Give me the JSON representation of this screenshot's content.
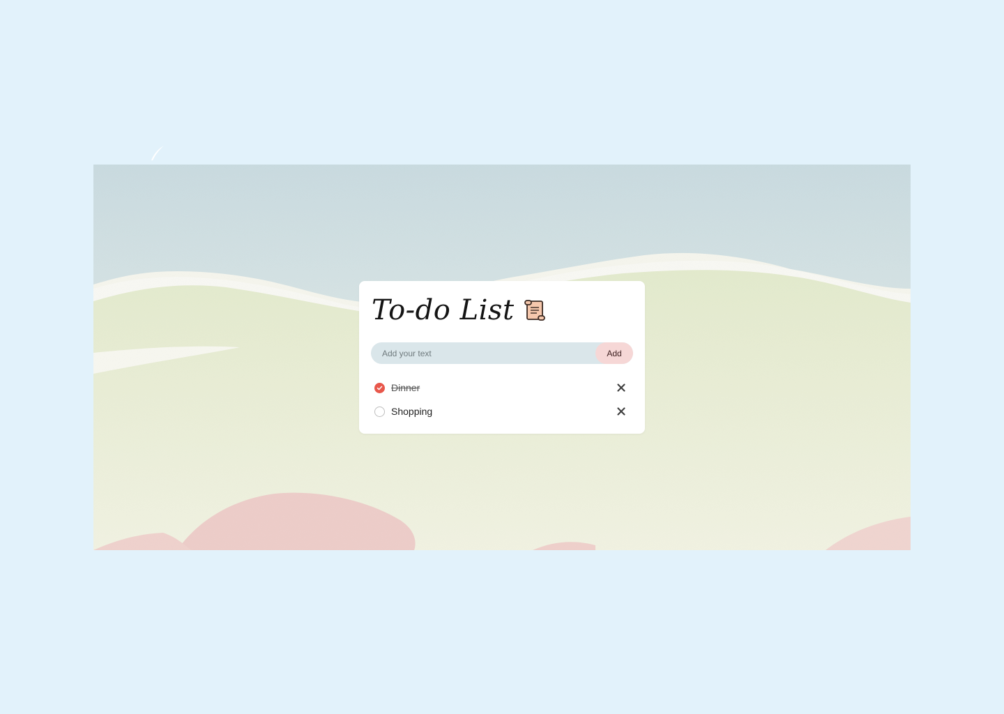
{
  "colors": {
    "page_background": "#e2f2fb",
    "input_background": "#dae6ea",
    "add_button_background": "#f6d7d6",
    "checked_color": "#e8574b"
  },
  "decor": {
    "brush_icon": "feather-stroke-icon",
    "painting": "watercolor-landscape"
  },
  "card": {
    "title": "To-do List",
    "title_icon": "scroll-icon"
  },
  "input": {
    "placeholder": "Add your text",
    "value": "",
    "button_label": "Add"
  },
  "tasks": [
    {
      "label": "Dinner",
      "completed": true,
      "delete_icon": "close-icon"
    },
    {
      "label": "Shopping",
      "completed": false,
      "delete_icon": "close-icon"
    }
  ]
}
